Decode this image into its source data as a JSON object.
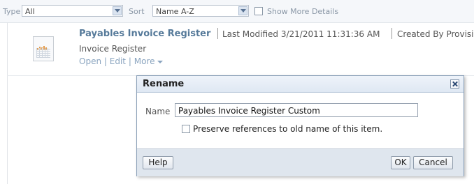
{
  "toolbar": {
    "type_label": "Type",
    "type_value": "All",
    "sort_label": "Sort",
    "sort_value": "Name A-Z",
    "show_more_label": "Show More Details"
  },
  "item": {
    "title": "Payables Invoice Register",
    "last_modified": "Last Modified 3/21/2011 11:31:36 AM",
    "created_by": "Created By Provisi",
    "description": "Invoice Register",
    "open": "Open",
    "edit": "Edit",
    "more": "More",
    "link_sep": "|",
    "icon": "report-icon"
  },
  "dialog": {
    "title": "Rename",
    "name_label": "Name",
    "name_value": "Payables Invoice Register Custom",
    "preserve_label": "Preserve references to old name of this item.",
    "help": "Help",
    "ok": "OK",
    "cancel": "Cancel"
  }
}
